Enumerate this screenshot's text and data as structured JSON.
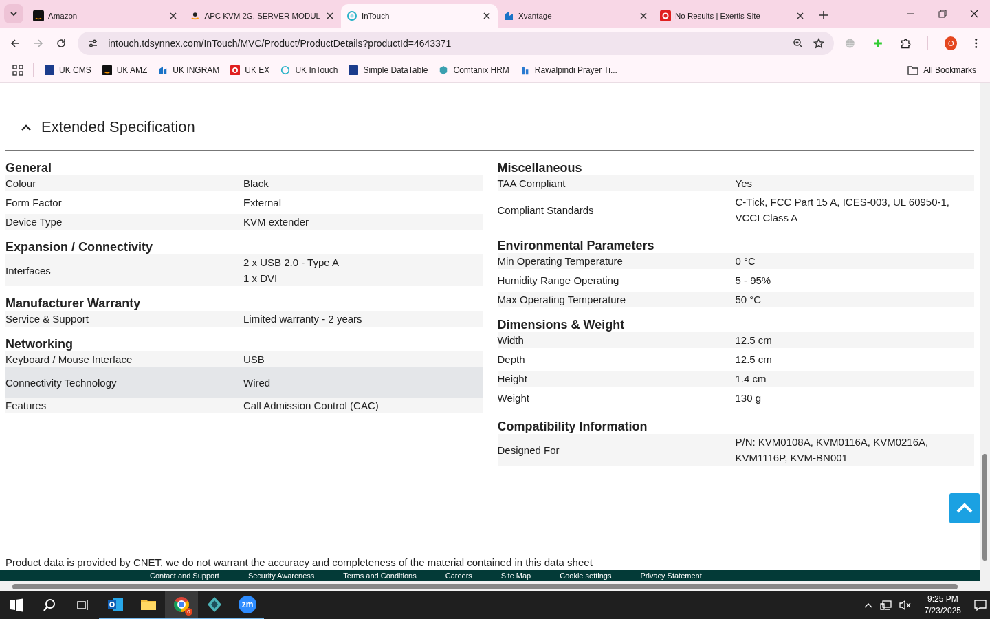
{
  "browser": {
    "tabs": [
      {
        "title": "Amazon",
        "selected": false
      },
      {
        "title": "APC KVM 2G, SERVER MODUL",
        "selected": false
      },
      {
        "title": "InTouch",
        "selected": true
      },
      {
        "title": "Xvantage",
        "selected": false
      },
      {
        "title": "No Results | Exertis Site",
        "selected": false
      }
    ],
    "url": "intouch.tdsynnex.com/InTouch/MVC/Product/ProductDetails?productId=4643371",
    "profile_initial": "O",
    "bookmarks": [
      "UK CMS",
      "UK AMZ",
      "UK INGRAM",
      "UK EX",
      "UK InTouch",
      "Simple DataTable",
      "Comtanix HRM",
      "Rawalpindi Prayer Ti..."
    ],
    "all_bookmarks": "All Bookmarks"
  },
  "page": {
    "section_title": "Extended Specification",
    "expanded": true,
    "columns": [
      [
        {
          "heading": "General",
          "rows": [
            {
              "label": "Colour",
              "value": "Black",
              "highlighted": false
            },
            {
              "label": "Form Factor",
              "value": "External",
              "highlighted": false
            },
            {
              "label": "Device Type",
              "value": "KVM extender",
              "highlighted": false
            }
          ]
        },
        {
          "heading": "Expansion / Connectivity",
          "rows": [
            {
              "label": "Interfaces",
              "value_lines": [
                "2 x USB 2.0 - Type A",
                "1 x DVI"
              ],
              "highlighted": false
            }
          ]
        },
        {
          "heading": "Manufacturer Warranty",
          "rows": [
            {
              "label": "Service & Support",
              "value": "Limited warranty - 2 years",
              "highlighted": false
            }
          ]
        },
        {
          "heading": "Networking",
          "rows": [
            {
              "label": "Keyboard / Mouse Interface",
              "value": "USB",
              "highlighted": false
            },
            {
              "label": "Connectivity Technology",
              "value": "Wired",
              "highlighted": true
            },
            {
              "label": "Features",
              "value": "Call Admission Control (CAC)",
              "highlighted": false
            }
          ]
        }
      ],
      [
        {
          "heading": "Miscellaneous",
          "rows": [
            {
              "label": "TAA Compliant",
              "value": "Yes",
              "highlighted": false
            },
            {
              "label": "Compliant Standards",
              "value": "C-Tick, FCC Part 15 A, ICES-003, UL 60950-1, VCCI Class A",
              "highlighted": false
            }
          ]
        },
        {
          "heading": "Environmental Parameters",
          "rows": [
            {
              "label": "Min Operating Temperature",
              "value": "0 °C",
              "highlighted": false
            },
            {
              "label": "Humidity Range Operating",
              "value": "5 - 95%",
              "highlighted": false
            },
            {
              "label": "Max Operating Temperature",
              "value": "50 °C",
              "highlighted": false
            }
          ]
        },
        {
          "heading": "Dimensions & Weight",
          "rows": [
            {
              "label": "Width",
              "value": "12.5 cm",
              "highlighted": false
            },
            {
              "label": "Depth",
              "value": "12.5 cm",
              "highlighted": false
            },
            {
              "label": "Height",
              "value": "1.4 cm",
              "highlighted": false
            },
            {
              "label": "Weight",
              "value": "130 g",
              "highlighted": false
            }
          ]
        },
        {
          "heading": "Compatibility Information",
          "rows": [
            {
              "label": "Designed For",
              "value": "P/N: KVM0108A, KVM0116A, KVM0216A, KVM1116P, KVM-BN001",
              "highlighted": false
            }
          ]
        }
      ]
    ],
    "disclaimer": "Product data is provided by CNET, we do not warrant the accuracy and completeness of the material contained in this data sheet",
    "footer_links": [
      "Contact and Support",
      "Security Awareness",
      "Terms and Conditions",
      "Careers",
      "Site Map",
      "Cookie settings",
      "Privacy Statement"
    ]
  },
  "taskbar": {
    "apps": [
      {
        "active": false
      },
      {
        "active": false
      },
      {
        "active": true
      },
      {
        "active": false
      },
      {
        "active": false
      }
    ],
    "zoom_label": "zm",
    "chrome_badge": "0",
    "time": "9:25 PM",
    "date": "7/23/2025"
  }
}
